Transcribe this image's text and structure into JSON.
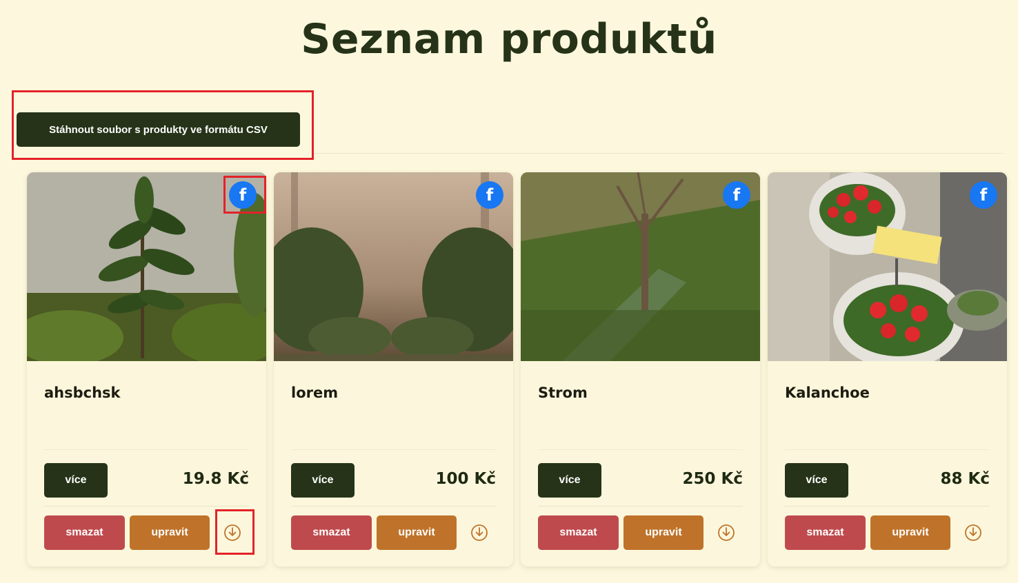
{
  "page": {
    "title": "Seznam produktů",
    "csv_button_label": "Stáhnout soubor s produkty ve formátu CSV"
  },
  "colors": {
    "background": "#fdf8dd",
    "primary": "#263318",
    "delete": "#bf4a4d",
    "edit": "#bf732a",
    "facebook": "#1877f2",
    "highlight": "#e32229"
  },
  "products": [
    {
      "name": "ahsbchsk",
      "price": "19.8 Kč",
      "more_label": "více",
      "delete_label": "smazat",
      "edit_label": "upravit",
      "share_icon": "facebook-icon",
      "download_icon": "download-icon"
    },
    {
      "name": "lorem",
      "price": "100 Kč",
      "more_label": "více",
      "delete_label": "smazat",
      "edit_label": "upravit",
      "share_icon": "facebook-icon",
      "download_icon": "download-icon"
    },
    {
      "name": "Strom",
      "price": "250 Kč",
      "more_label": "více",
      "delete_label": "smazat",
      "edit_label": "upravit",
      "share_icon": "facebook-icon",
      "download_icon": "download-icon"
    },
    {
      "name": "Kalanchoe",
      "price": "88 Kč",
      "more_label": "více",
      "delete_label": "smazat",
      "edit_label": "upravit",
      "share_icon": "facebook-icon",
      "download_icon": "download-icon"
    }
  ]
}
